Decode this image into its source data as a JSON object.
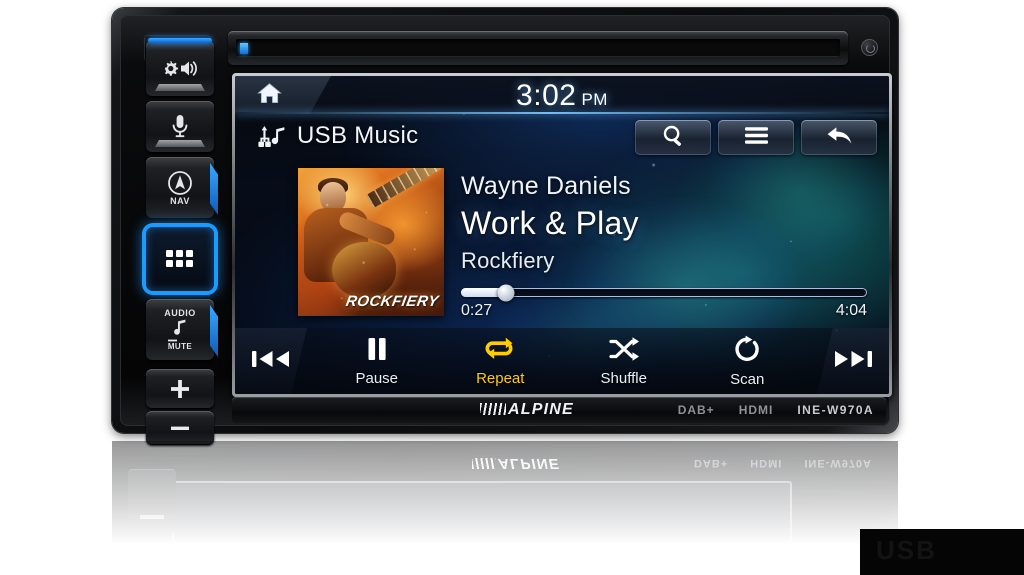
{
  "device": {
    "brand": "ALPINE",
    "model": "INE-W970A",
    "badges": [
      "DAB+",
      "HDMI"
    ]
  },
  "hard_buttons": [
    {
      "name": "illumination-audio",
      "icon": "gear-speaker-icon",
      "label": ""
    },
    {
      "name": "voice-command",
      "icon": "microphone-icon",
      "label": ""
    },
    {
      "name": "navigation",
      "icon": "compass-icon",
      "label": "NAV"
    },
    {
      "name": "apps-grid",
      "icon": "grid-icon",
      "label": ""
    },
    {
      "name": "audio-mute",
      "icon": "music-note-icon",
      "label_top": "AUDIO",
      "label_bottom": "MUTE"
    },
    {
      "name": "volume-up",
      "icon": "plus-icon",
      "label": ""
    },
    {
      "name": "volume-down",
      "icon": "minus-icon",
      "label": ""
    }
  ],
  "screen": {
    "status": {
      "home_icon": "home-icon",
      "clock_time": "3:02",
      "clock_ampm": "PM"
    },
    "source": {
      "icon": "usb-music-icon",
      "label": "USB Music"
    },
    "top_buttons": [
      {
        "name": "search-button",
        "icon": "search-icon"
      },
      {
        "name": "menu-button",
        "icon": "hamburger-menu-icon"
      },
      {
        "name": "back-button",
        "icon": "back-arrow-icon"
      }
    ],
    "now_playing": {
      "artist": "Wayne Daniels",
      "title": "Work & Play",
      "album": "Rockfiery",
      "album_art_caption": "ROCKFIERY",
      "elapsed": "0:27",
      "duration": "4:04",
      "progress_percent": 11
    },
    "transport": {
      "previous": {
        "label": "",
        "icon": "previous-track-icon"
      },
      "next": {
        "label": "",
        "icon": "next-track-icon"
      },
      "items": [
        {
          "name": "pause",
          "label": "Pause",
          "icon": "pause-icon",
          "active": false
        },
        {
          "name": "repeat",
          "label": "Repeat",
          "icon": "repeat-icon",
          "active": true
        },
        {
          "name": "shuffle",
          "label": "Shuffle",
          "icon": "shuffle-icon",
          "active": false
        },
        {
          "name": "scan",
          "label": "Scan",
          "icon": "scan-icon",
          "active": false
        }
      ]
    },
    "accent_active_color": "#ffcc00"
  },
  "watermark": {
    "text": "USB"
  }
}
